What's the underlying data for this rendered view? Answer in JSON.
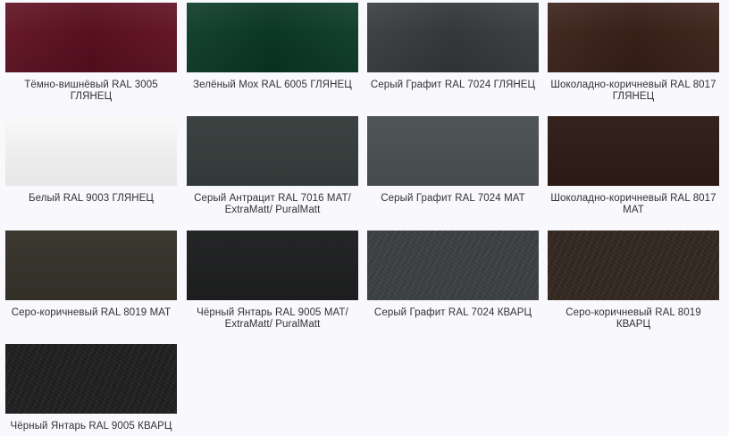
{
  "swatches": [
    {
      "label": "Тёмно-вишнёвый RAL 3005 ГЛЯНЕЦ",
      "color": "#5e1020",
      "finish": "glossy"
    },
    {
      "label": "Зелёный Мох RAL 6005 ГЛЯНЕЦ",
      "color": "#0b3a26",
      "finish": "glossy"
    },
    {
      "label": "Серый Графит RAL 7024 ГЛЯНЕЦ",
      "color": "#373b3d",
      "finish": "glossy"
    },
    {
      "label": "Шоколадно-коричневый RAL 8017 ГЛЯНЕЦ",
      "color": "#3a2119",
      "finish": "glossy"
    },
    {
      "label": "Белый RAL 9003 ГЛЯНЕЦ",
      "color": "#f1f1f1",
      "finish": "white-gloss"
    },
    {
      "label": "Серый Антрацит RAL 7016 МАТ/ ExtraMatt/ PuralMatt",
      "color": "#353d3c",
      "finish": "matt"
    },
    {
      "label": "Серый Графит RAL 7024 МАТ",
      "color": "#4a5050",
      "finish": "matt"
    },
    {
      "label": "Шоколадно-коричневый RAL 8017 МАТ",
      "color": "#2e1b15",
      "finish": "matt"
    },
    {
      "label": "Серо-коричневый RAL 8019 МАТ",
      "color": "#35322a",
      "finish": "matt"
    },
    {
      "label": "Чёрный Янтарь RAL 9005 МАТ/ ExtraMatt/ PuralMatt",
      "color": "#1e1f20",
      "finish": "matt"
    },
    {
      "label": "Серый Графит RAL 7024 КВАРЦ",
      "color": "#3b3f41",
      "finish": "quartz"
    },
    {
      "label": "Серо-коричневый RAL 8019 КВАРЦ",
      "color": "#33281f",
      "finish": "quartz"
    },
    {
      "label": "Чёрный Янтарь RAL 9005 КВАРЦ",
      "color": "#1f1f1f",
      "finish": "quartz"
    }
  ]
}
